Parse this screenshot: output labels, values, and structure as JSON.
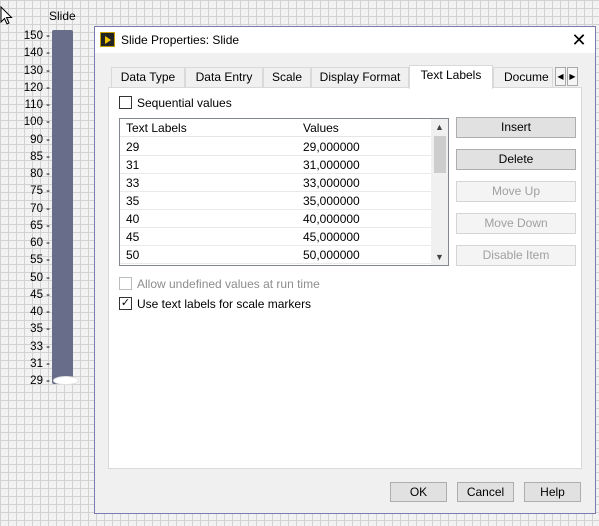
{
  "front_panel": {
    "slide_label": "Slide",
    "scale_ticks": [
      "150",
      "140",
      "130",
      "120",
      "110",
      "100",
      "90",
      "85",
      "80",
      "75",
      "70",
      "65",
      "60",
      "55",
      "50",
      "45",
      "40",
      "35",
      "33",
      "31",
      "29"
    ]
  },
  "dialog": {
    "title": "Slide Properties: Slide",
    "tabs": [
      "Data Type",
      "Data Entry",
      "Scale",
      "Display Format",
      "Text Labels",
      "Docume"
    ],
    "active_tab": "Text Labels",
    "sequential_values_label": "Sequential values",
    "table": {
      "headers": [
        "Text Labels",
        "Values"
      ],
      "rows": [
        [
          "29",
          "29,000000"
        ],
        [
          "31",
          "31,000000"
        ],
        [
          "33",
          "33,000000"
        ],
        [
          "35",
          "35,000000"
        ],
        [
          "40",
          "40,000000"
        ],
        [
          "45",
          "45,000000"
        ],
        [
          "50",
          "50,000000"
        ]
      ]
    },
    "buttons": {
      "insert": "Insert",
      "delete": "Delete",
      "move_up": "Move Up",
      "move_down": "Move Down",
      "disable_item": "Disable Item"
    },
    "allow_undefined_label": "Allow undefined values at run time",
    "use_text_labels_label": "Use text labels for scale markers",
    "footer": {
      "ok": "OK",
      "cancel": "Cancel",
      "help": "Help"
    }
  }
}
